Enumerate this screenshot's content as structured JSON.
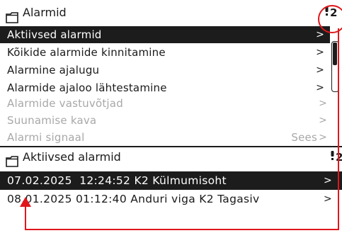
{
  "top": {
    "title": "Alarmid",
    "alarm_count": "2",
    "items": [
      {
        "label": "Aktiivsed alarmid",
        "arrow": ">"
      },
      {
        "label": "Kõikide alarmide kinnitamine",
        "arrow": ">"
      },
      {
        "label": "Alarmine ajalugu",
        "arrow": ">"
      },
      {
        "label": "Alarmide ajaloo lähtestamine",
        "arrow": ">"
      },
      {
        "label": "Alarmide vastuvõtjad",
        "arrow": ">"
      },
      {
        "label": "Suunamise kava",
        "arrow": ">"
      },
      {
        "label": "Alarmi signaal",
        "value": "Sees",
        "arrow": ">"
      }
    ]
  },
  "bottom": {
    "title": "Aktiivsed alarmid",
    "alarm_count": "2",
    "alarms": [
      {
        "label": "07.02.2025  12:24:52 K2 Külmumisoht",
        "arrow": ">"
      },
      {
        "label": "08.01.2025 01:12:40 Anduri viga K2 Tagasiv",
        "arrow": ">"
      }
    ]
  },
  "colors": {
    "selected_bg": "#1c1c1c",
    "disabled_text": "#a8a8a8",
    "annotation_red": "#e0161b"
  },
  "icons": [
    "folder-icon",
    "alarm-bell-icon"
  ]
}
